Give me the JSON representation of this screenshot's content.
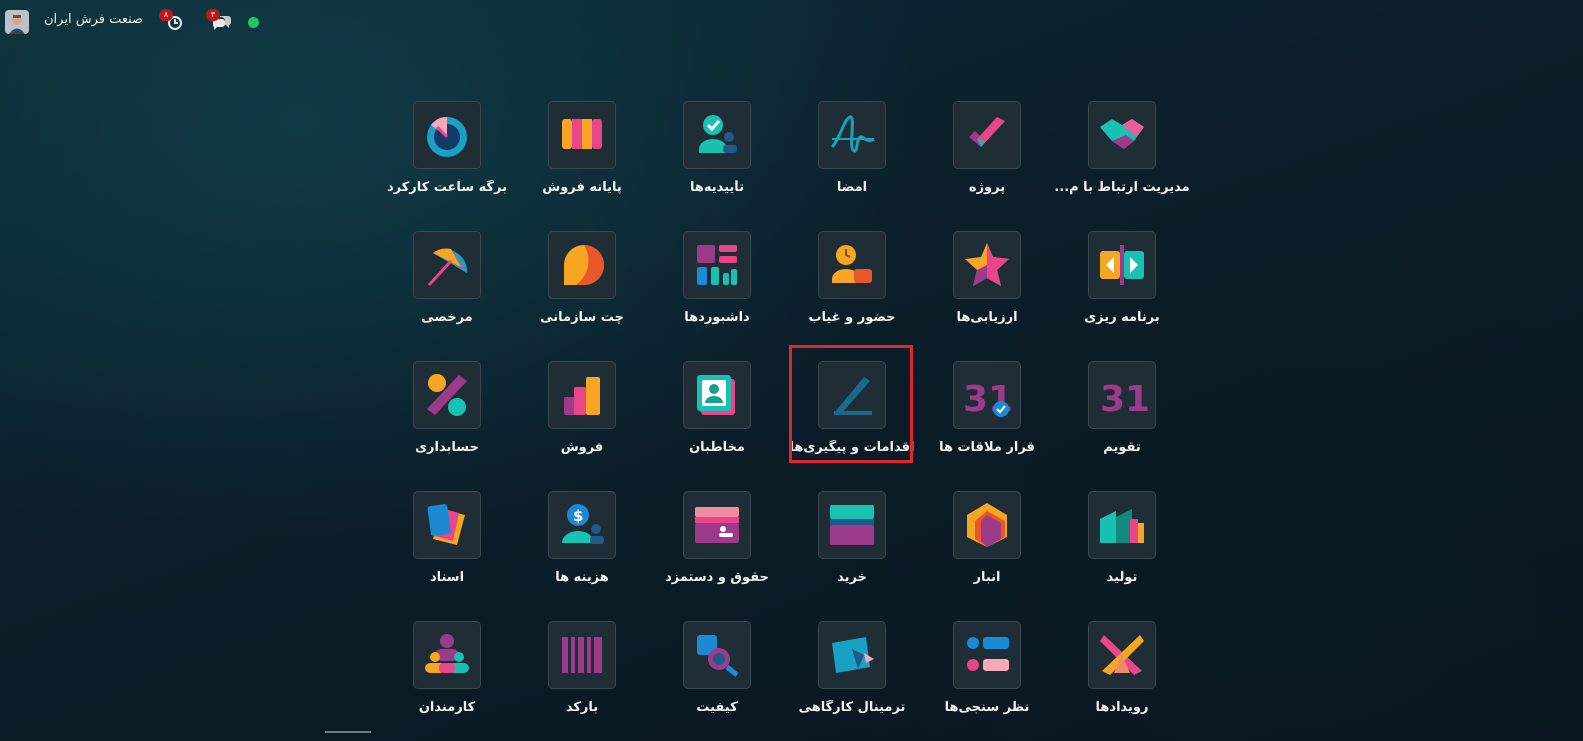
{
  "company_name": "صنعت فرش ایران",
  "badges": {
    "activity": "۸",
    "messages": "۳"
  },
  "apps": [
    {
      "id": "crm",
      "label": "مدیریت ارتباط با م..."
    },
    {
      "id": "project",
      "label": "پروژه"
    },
    {
      "id": "sign",
      "label": "امضا"
    },
    {
      "id": "approvals",
      "label": "تأییدیه‌ها"
    },
    {
      "id": "pos",
      "label": "پایانه فروش"
    },
    {
      "id": "timesheet",
      "label": "برگه ساعت کارکرد"
    },
    {
      "id": "planning",
      "label": "برنامه ریزی"
    },
    {
      "id": "appraisal",
      "label": "ارزیابی‌ها"
    },
    {
      "id": "attendance",
      "label": "حضور و غیاب"
    },
    {
      "id": "dashboards",
      "label": "داشبوردها"
    },
    {
      "id": "discuss",
      "label": "چت سازمانی"
    },
    {
      "id": "timeoff",
      "label": "مرخصی"
    },
    {
      "id": "calendar",
      "label": "تقویم",
      "icon_text": "31"
    },
    {
      "id": "appointments",
      "label": "قرار ملاقات ها",
      "icon_text": "31"
    },
    {
      "id": "todo",
      "label": "اقدامات و پیگیری‌ها"
    },
    {
      "id": "contacts",
      "label": "مخاطبان"
    },
    {
      "id": "sales",
      "label": "فروش"
    },
    {
      "id": "accounting",
      "label": "حسابداری"
    },
    {
      "id": "manufacturing",
      "label": "تولید"
    },
    {
      "id": "inventory",
      "label": "انبار"
    },
    {
      "id": "purchase",
      "label": "خرید"
    },
    {
      "id": "payroll",
      "label": "حقوق و دستمزد"
    },
    {
      "id": "expenses",
      "label": "هزینه ها"
    },
    {
      "id": "documents",
      "label": "اسناد"
    },
    {
      "id": "events",
      "label": "رویدادها"
    },
    {
      "id": "surveys",
      "label": "نظر سنجی‌ها"
    },
    {
      "id": "shopfloor",
      "label": "ترمینال کارگاهی"
    },
    {
      "id": "quality",
      "label": "کیفیت"
    },
    {
      "id": "barcode",
      "label": "بارکد"
    },
    {
      "id": "employees",
      "label": "کارمندان"
    }
  ]
}
